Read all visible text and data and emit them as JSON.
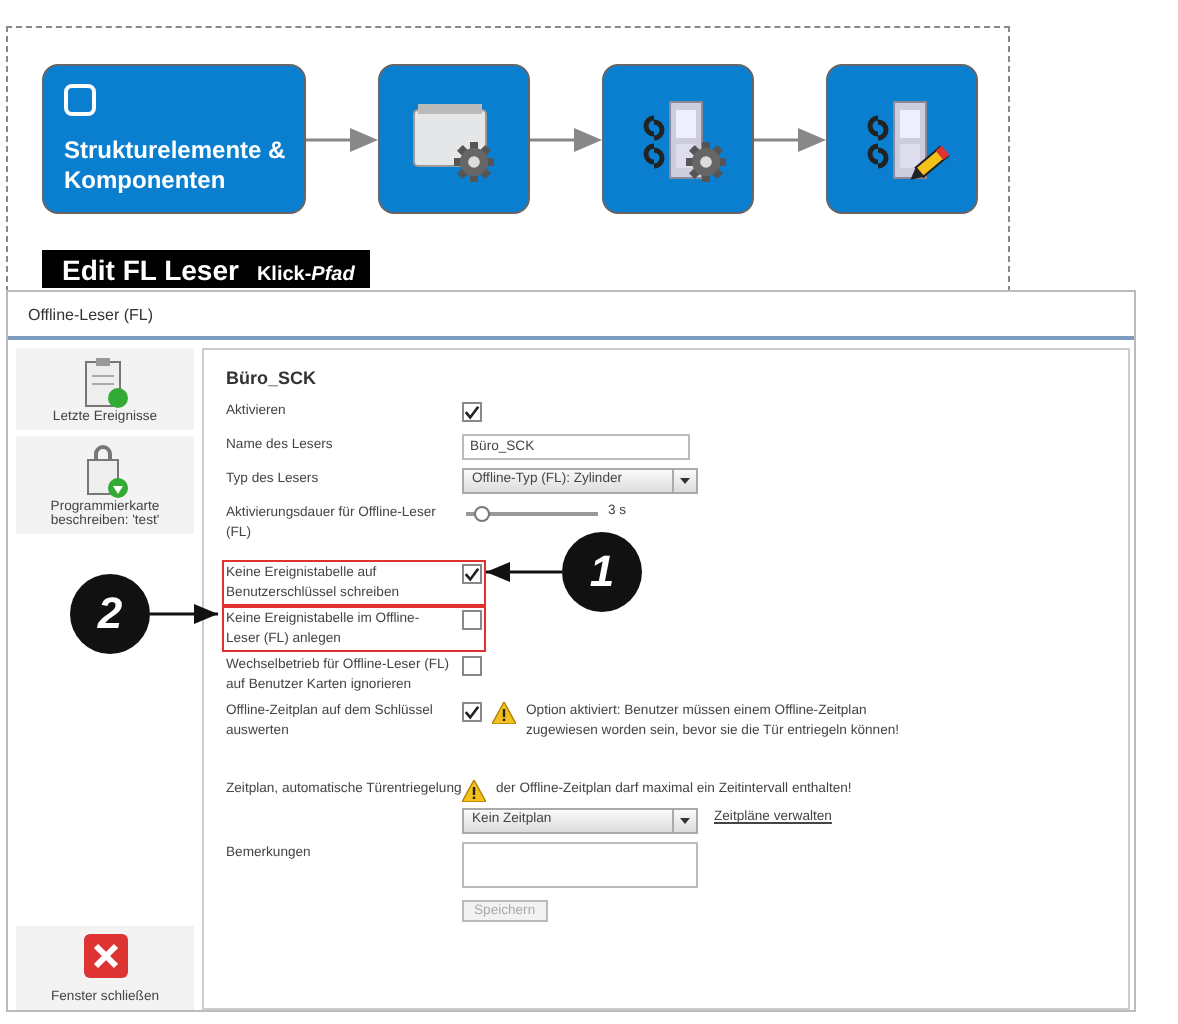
{
  "diagram": {
    "first_step": {
      "label": "Strukturelemente & Komponenten"
    }
  },
  "caption": {
    "title": "Edit FL Leser",
    "subtitle": "Klick-*Pfad*"
  },
  "window": {
    "title": "Offline-Leser (FL)"
  },
  "sidebar": {
    "items": [
      {
        "label": "Letzte Ereignisse"
      },
      {
        "label": "Programmierkarte beschreiben: 'test'"
      }
    ],
    "close": {
      "label": "Fenster schließen"
    }
  },
  "form": {
    "heading": "Büro_SCK",
    "rows": [
      {
        "kind": "checkbox",
        "label": "Aktivieren",
        "checked": true
      },
      {
        "kind": "text",
        "label": "Name des Lesers",
        "value": "Büro_SCK"
      },
      {
        "kind": "select",
        "label": "Typ des Lesers",
        "value": "Offline-Typ (FL): Zylinder"
      },
      {
        "kind": "slider",
        "label": "Aktivierungsdauer für Offline-Leser (FL)",
        "level": 0.12,
        "reading": "3 s"
      },
      {
        "kind": "checkbox",
        "label": "Keine Ereignistabelle auf Benutzerschlüssel schreiben",
        "checked": true,
        "highlighted": true
      },
      {
        "kind": "checkbox",
        "label": "Keine Ereignistabelle im Offline-Leser (FL) anlegen",
        "checked": false,
        "highlighted": true
      },
      {
        "kind": "checkbox",
        "label": "Wechselbetrieb für Offline-Leser (FL) auf Benutzer Karten ignorieren",
        "checked": false
      },
      {
        "kind": "checkbox",
        "label": "Offline-Zeitplan auf dem Schlüssel auswerten",
        "checked": true,
        "warning": "Option aktiviert: Benutzer müssen einem Offline-Zeitplan zugewiesen worden sein, bevor sie die Tür entriegeln können!"
      },
      {
        "kind": "warning",
        "label": "Zeitplan, automatische Türentriegelung",
        "warning": "der Offline-Zeitplan darf maximal ein Zeitintervall enthalten!"
      },
      {
        "kind": "select",
        "value": "Kein Zeitplan",
        "link": "Zeitpläne verwalten"
      },
      {
        "kind": "textarea",
        "label": "Bemerkungen"
      }
    ],
    "save": {
      "label": "Speichern",
      "disabled": true
    }
  },
  "callouts": [
    {
      "number": "1"
    },
    {
      "number": "2"
    }
  ]
}
